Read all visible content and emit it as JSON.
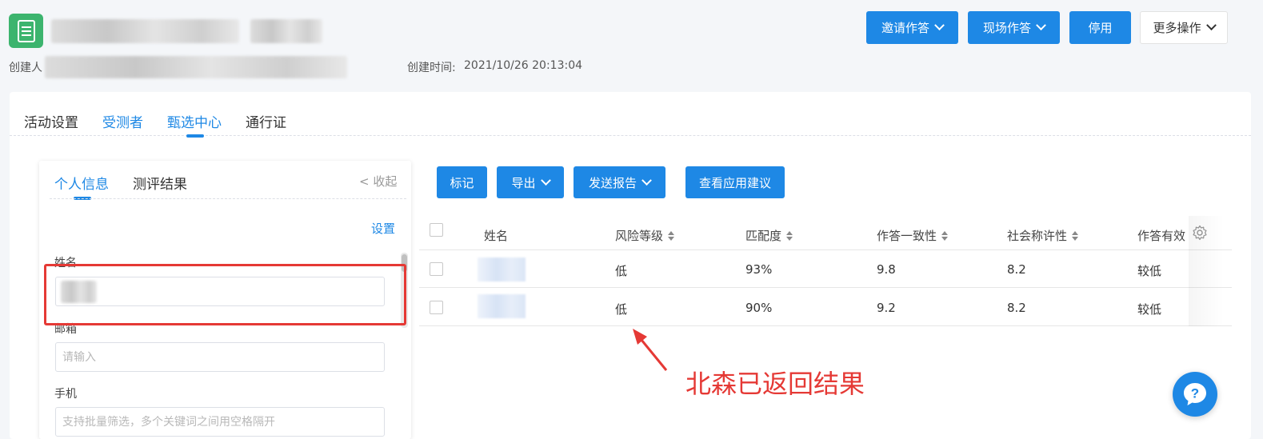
{
  "header": {
    "creator_label": "创建人",
    "created_time_label": "创建时间:",
    "created_time": "2021/10/26 20:13:04",
    "buttons": {
      "invite": "邀请作答",
      "onsite": "现场作答",
      "disable": "停用",
      "more": "更多操作"
    }
  },
  "tabs": [
    "活动设置",
    "受测者",
    "甄选中心",
    "通行证"
  ],
  "panel": {
    "tabs": [
      "个人信息",
      "测评结果"
    ],
    "collapse": "< 收起",
    "settings": "设置",
    "fields": {
      "name_label": "姓名",
      "email_label": "邮箱",
      "email_placeholder": "请输入",
      "phone_label": "手机",
      "phone_placeholder": "支持批量筛选，多个关键词之间用空格隔开"
    }
  },
  "toolbar": {
    "mark": "标记",
    "export": "导出",
    "send_report": "发送报告",
    "view_suggestion": "查看应用建议"
  },
  "table": {
    "columns": [
      "姓名",
      "风险等级",
      "匹配度",
      "作答一致性",
      "社会称许性",
      "作答有效"
    ],
    "rows": [
      {
        "risk": "低",
        "match": "93%",
        "consistency": "9.8",
        "social": "8.2",
        "validity": "较低"
      },
      {
        "risk": "低",
        "match": "90%",
        "consistency": "9.2",
        "social": "8.2",
        "validity": "较低"
      }
    ]
  },
  "annotation": "北森已返回结果",
  "colors": {
    "primary": "#1e88e5",
    "app_icon": "#3cb46e",
    "annotation": "#e53935"
  }
}
